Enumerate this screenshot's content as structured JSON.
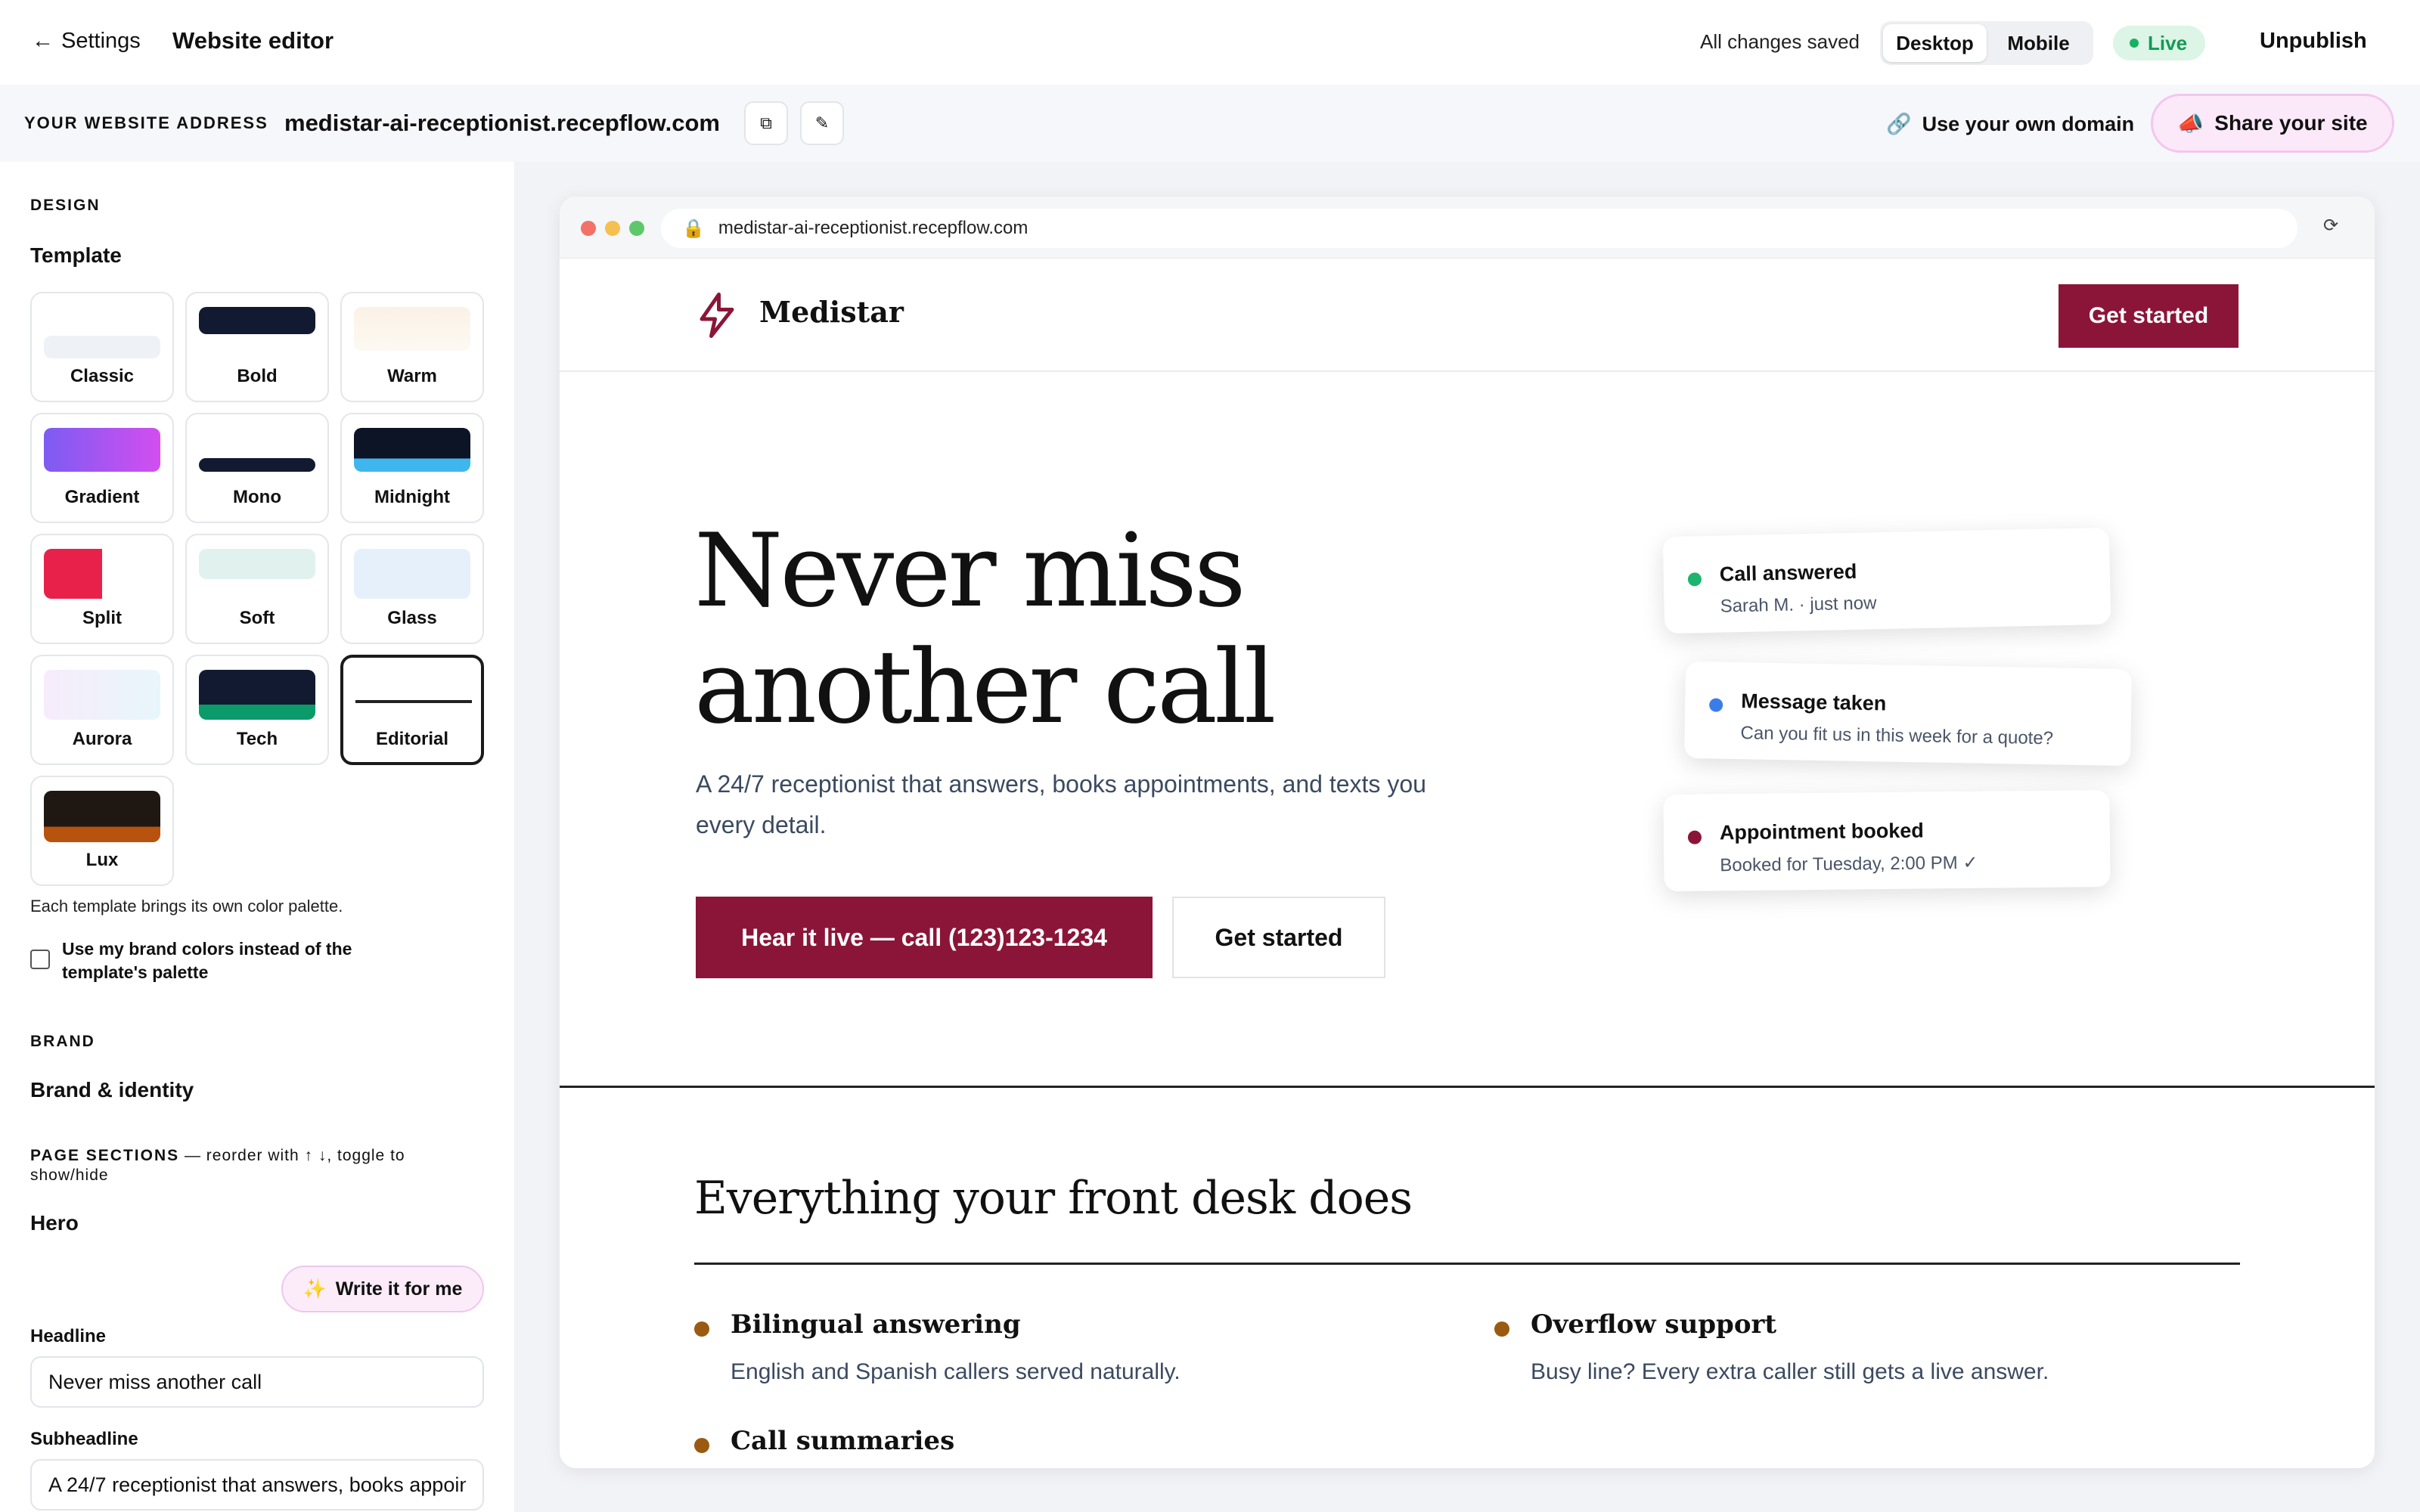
{
  "topbar": {
    "back_label": "Settings",
    "title": "Website editor",
    "saved_status": "All changes saved",
    "view_modes": [
      "Desktop",
      "Mobile"
    ],
    "active_view": "Desktop",
    "live_badge": "Live",
    "unpublish_label": "Unpublish"
  },
  "address": {
    "label": "YOUR WEBSITE ADDRESS",
    "value": "medistar-ai-receptionist.recepflow.com",
    "own_domain_label": "Use your own domain",
    "share_label": "Share your site"
  },
  "sidebar": {
    "design_label": "DESIGN",
    "template_title": "Template",
    "templates": [
      "Classic",
      "Bold",
      "Warm",
      "Gradient",
      "Mono",
      "Midnight",
      "Split",
      "Soft",
      "Glass",
      "Aurora",
      "Tech",
      "Editorial",
      "Lux"
    ],
    "selected_template": "Editorial",
    "template_note": "Each template brings its own color palette.",
    "brand_colors_checkbox": "Use my brand colors instead of the template's palette",
    "brand_colors_checked": false,
    "brand_label": "BRAND",
    "brand_title": "Brand & identity",
    "page_sections_label": "PAGE SECTIONS",
    "page_sections_hint": " — reorder with ↑ ↓, toggle to show/hide",
    "hero_title": "Hero",
    "write_it_label": "Write it for me",
    "headline_label": "Headline",
    "headline_value": "Never miss another call",
    "subheadline_label": "Subheadline",
    "subheadline_value": "A 24/7 receptionist that answers, books appointments, and texts you every detail."
  },
  "preview": {
    "url": "medistar-ai-receptionist.recepflow.com",
    "site": {
      "brand": "Medistar",
      "nav_cta": "Get started",
      "hero_line1": "Never miss",
      "hero_line2": "another call",
      "hero_sub": "A 24/7 receptionist that answers, books appointments, and texts you every detail.",
      "cta_primary": "Hear it live — call (123)123-1234",
      "cta_secondary": "Get started",
      "cards": [
        {
          "title": "Call answered",
          "sub": "Sarah M. · just now",
          "color": "#1db46e"
        },
        {
          "title": "Message taken",
          "sub": "Can you fit us in this week for a quote?",
          "color": "#3b7de8"
        },
        {
          "title": "Appointment booked",
          "sub": "Booked for Tuesday, 2:00 PM ✓",
          "color": "#8b1538"
        }
      ],
      "features_title": "Everything your front desk does",
      "features": [
        {
          "title": "Bilingual answering",
          "sub": "English and Spanish callers served naturally."
        },
        {
          "title": "Overflow support",
          "sub": "Busy line? Every extra caller still gets a live answer."
        },
        {
          "title": "Call summaries",
          "sub": ""
        }
      ]
    }
  },
  "colors": {
    "accent": "#8b1538",
    "feature_dot": "#9a5a12",
    "live_green": "#18b060"
  }
}
